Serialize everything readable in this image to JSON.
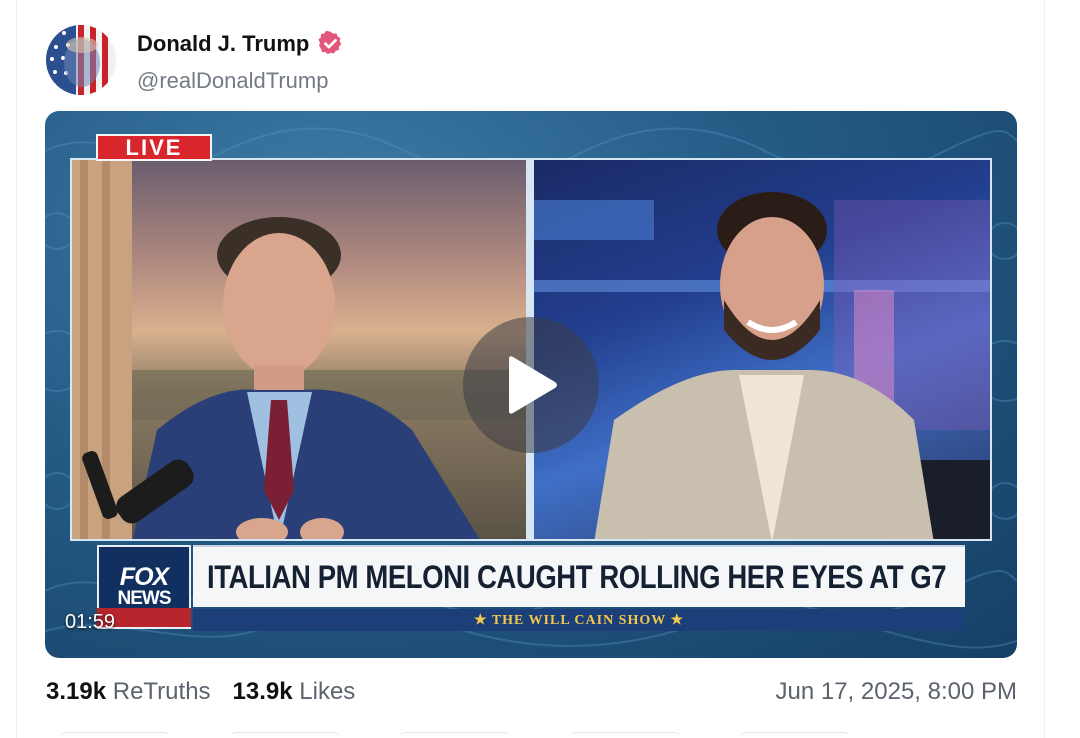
{
  "post": {
    "author": {
      "display_name": "Donald J. Trump",
      "handle": "@realDonaldTrump",
      "verified": true,
      "avatar_icon": "flag-portrait-avatar"
    },
    "video": {
      "live_badge": "LIVE",
      "headline": "ITALIAN PM MELONI CAUGHT ROLLING HER EYES AT G7",
      "network_logo_top": "FOX",
      "network_logo_bottom": "NEWS",
      "show_name": "★ THE WILL CAIN SHOW ★",
      "duration": "01:59",
      "play_icon": "play-icon"
    },
    "stats": {
      "retruths_count": "3.19k",
      "retruths_label": "ReTruths",
      "likes_count": "13.9k",
      "likes_label": "Likes"
    },
    "timestamp": "Jun 17, 2025, 8:00 PM"
  },
  "colors": {
    "verified_badge": "#e4577d",
    "live_red": "#d8262c",
    "fox_blue": "#12305f",
    "video_bg": "#245c86"
  }
}
